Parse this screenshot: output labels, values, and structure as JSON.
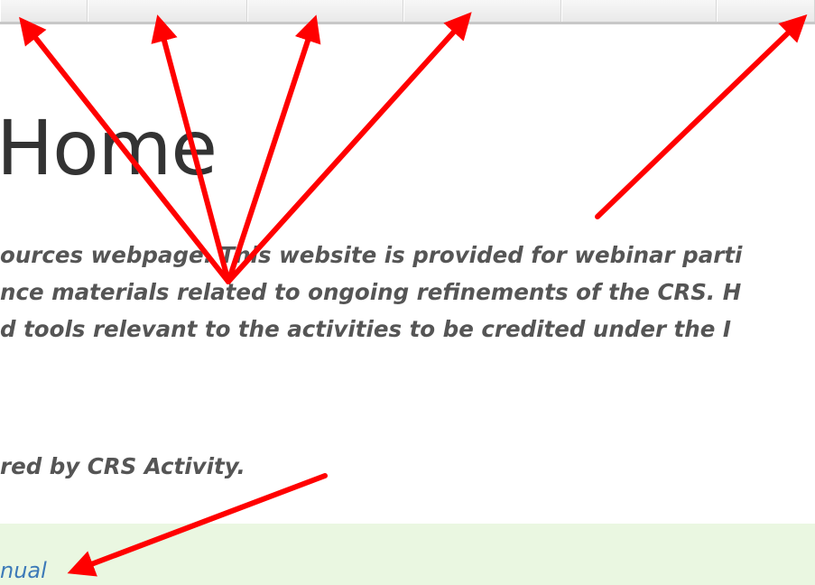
{
  "header": {
    "title": "Home"
  },
  "intro": {
    "lines": [
      "ources webpage. This website is provided for webinar parti",
      "nce materials related to ongoing refinements of the CRS. H",
      "d tools relevant to the activities to be credited under the I"
    ]
  },
  "subnote": {
    "text": "red by CRS Activity."
  },
  "notice": {
    "link_label": "nual",
    "background": "#eaf7e1",
    "link_color": "#3d7ab8"
  },
  "annotations": {
    "arrow_color": "#ff0000",
    "arrow_count": 6
  }
}
